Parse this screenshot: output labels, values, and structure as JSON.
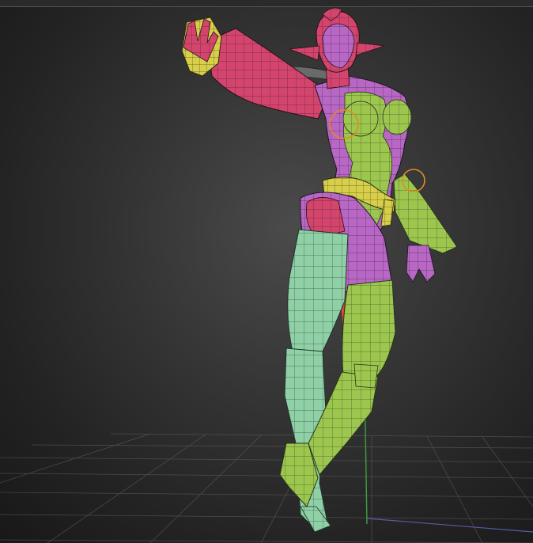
{
  "viewport": {
    "background_center": "#4b4b4b",
    "background_edge": "#181818",
    "grid_color": "#6a6a6a",
    "axis_y_color": "#3fa03f",
    "axis_x_color": "#5a5aa8"
  },
  "model": {
    "polygroup_colors": [
      "#d4456e",
      "#b868c4",
      "#9cc64e",
      "#8fd0a6",
      "#d7cf4a",
      "#e0483a"
    ],
    "wireframe_color": "#2a2a2a"
  },
  "selection_markers": {
    "color": "#e58a1f",
    "icon": "circle-gizmo-icon"
  }
}
